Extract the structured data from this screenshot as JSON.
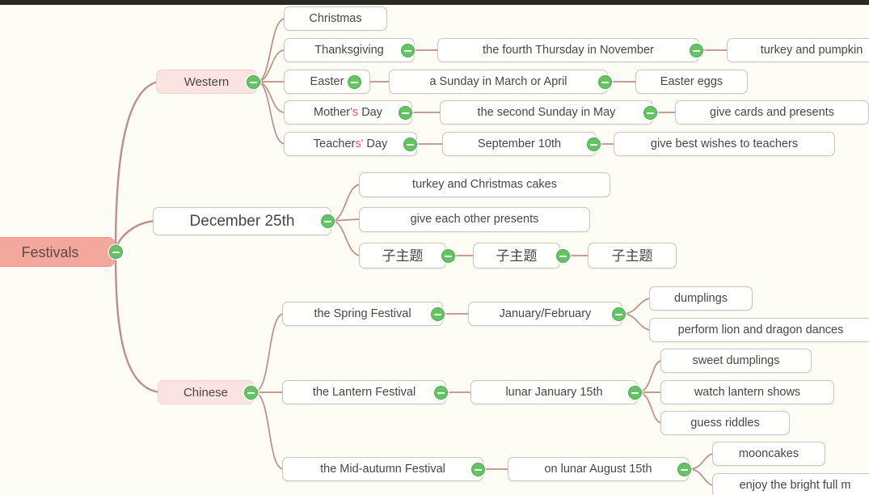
{
  "app": {
    "background_color": "#fdfcf5",
    "topbar_color": "#2b2823",
    "edge_color": "#c08d88",
    "toggle_color": "#64c364",
    "root_color": "#f4a79c",
    "category_color": "#fbe3e1",
    "mark_color": "#e8576b"
  },
  "mindmap": {
    "root": {
      "label": "Festivals"
    },
    "nodes": {
      "western": "Western",
      "christmas": "Christmas",
      "thanksgiving_pre": "Thanks",
      "thanksgiving": "Thanksgiving",
      "thanksgiving_date": "the fourth Thursday in November",
      "thanksgiving_food": "turkey and pumpkin",
      "easter": "Easter",
      "easter_date": "a Sunday in March or April",
      "easter_eggs": "Easter eggs",
      "mothers_day_a": "Mother",
      "mothers_day_mark": "'s",
      "mothers_day_b": " Day",
      "mothers_day_date": "the second Sunday in May",
      "mothers_day_act": "give cards and presents",
      "teachers_day_a": "Teacher",
      "teachers_day_mark": "s'",
      "teachers_day_b": " Day",
      "teachers_day_date": "September 10th",
      "teachers_day_act": "give best wishes to teachers",
      "december": "December 25th",
      "dec_food": "turkey and Christmas cakes",
      "dec_presents": "give each other presents",
      "subtopic_1": "子主题",
      "subtopic_2": "子主题",
      "subtopic_3": "子主题",
      "chinese": "Chinese",
      "spring_festival": "the Spring Festival",
      "spring_date": "January/February",
      "spring_food": "dumplings",
      "spring_act": "perform lion and dragon dances",
      "lantern_festival": "the Lantern Festival",
      "lantern_date": "lunar January 15th",
      "lantern_food": "sweet dumplings",
      "lantern_act1": "watch lantern shows",
      "lantern_act2": "guess riddles",
      "midautumn_festival": "the Mid-autumn Festival",
      "midautumn_date": "on lunar August 15th",
      "midautumn_food": "mooncakes",
      "midautumn_act": "enjoy the bright full m"
    }
  }
}
